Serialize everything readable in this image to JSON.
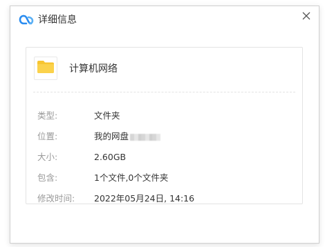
{
  "window": {
    "title": "详细信息",
    "logo_icon": "baidu-netdisk-logo-icon",
    "close_icon": "close-icon"
  },
  "file": {
    "icon": "folder-icon",
    "icon_color": "#F7C531",
    "name": "计算机网络"
  },
  "details": [
    {
      "label": "类型:",
      "value": "文件夹"
    },
    {
      "label": "位置:",
      "value": "我的网盘"
    },
    {
      "label": "大小:",
      "value": "2.60GB"
    },
    {
      "label": "包含:",
      "value": "1个文件,0个文件夹"
    },
    {
      "label": "修改时间:",
      "value": "2022年05月24日, 14:16"
    }
  ],
  "colors": {
    "logo_blue": "#2A8CF0",
    "label_gray": "#9A9A9A",
    "text_dark": "#333333"
  }
}
